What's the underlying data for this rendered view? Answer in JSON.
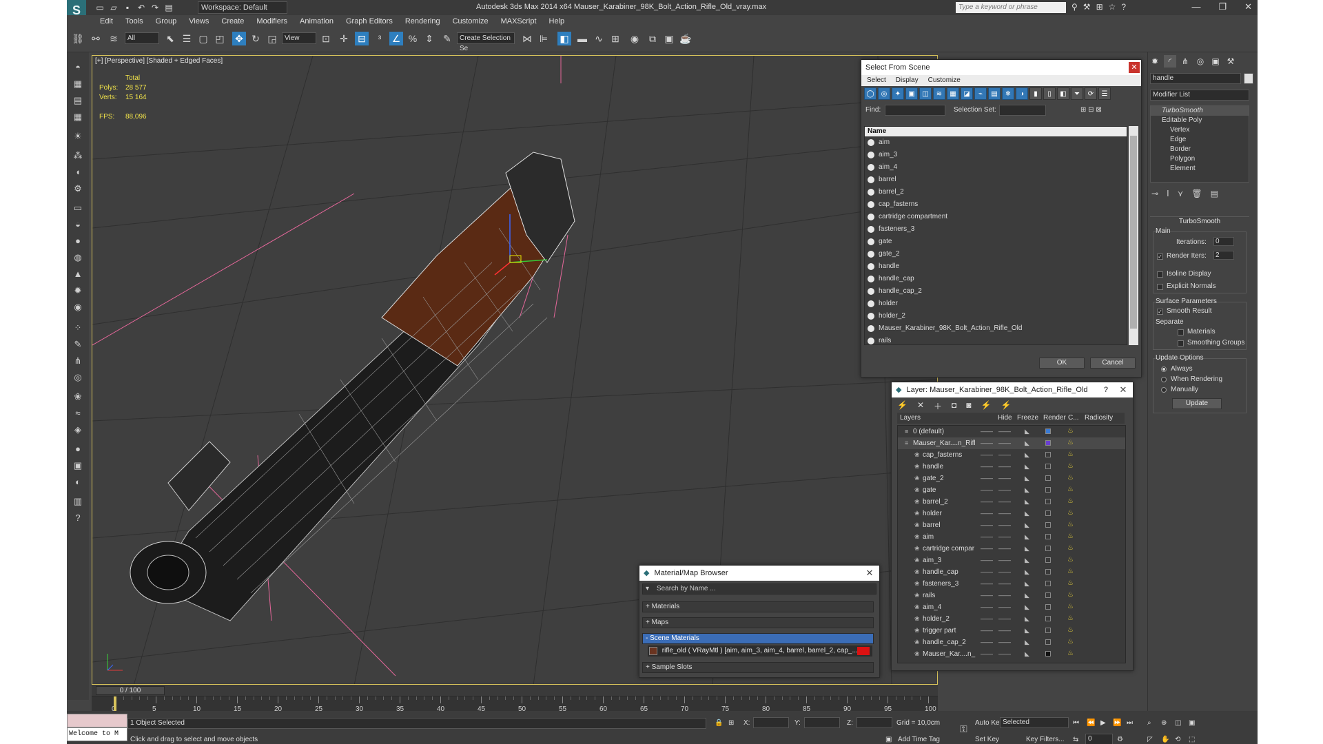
{
  "window": {
    "title": "Autodesk 3ds Max  2014 x64      Mauser_Karabiner_98K_Bolt_Action_Rifle_Old_vray.max",
    "workspace": "Workspace: Default",
    "search_placeholder": "Type a keyword or phrase"
  },
  "menu": [
    "Edit",
    "Tools",
    "Group",
    "Views",
    "Create",
    "Modifiers",
    "Animation",
    "Graph Editors",
    "Rendering",
    "Customize",
    "MAXScript",
    "Help"
  ],
  "toolbar": {
    "filter": "All",
    "ref_coord": "View",
    "selection_set": "Create Selection Se"
  },
  "viewport": {
    "label": "[+] [Perspective] [Shaded + Edged Faces]",
    "stats_header": "Total",
    "polys_label": "Polys:",
    "polys_value": "28 577",
    "verts_label": "Verts:",
    "verts_value": "15 164",
    "fps_label": "FPS:",
    "fps_value": "88,096"
  },
  "select_from_scene": {
    "title": "Select From Scene",
    "menu": [
      "Select",
      "Display",
      "Customize"
    ],
    "find_label": "Find:",
    "selection_set_label": "Selection Set:",
    "column_name": "Name",
    "items": [
      "aim",
      "aim_3",
      "aim_4",
      "barrel",
      "barrel_2",
      "cap_fasterns",
      "cartridge compartment",
      "fasteners_3",
      "gate",
      "gate_2",
      "handle",
      "handle_cap",
      "handle_cap_2",
      "holder",
      "holder_2",
      "Mauser_Karabiner_98K_Bolt_Action_Rifle_Old",
      "rails"
    ],
    "ok": "OK",
    "cancel": "Cancel"
  },
  "layer_dialog": {
    "title": "Layer: Mauser_Karabiner_98K_Bolt_Action_Rifle_Old",
    "help": "?",
    "columns": [
      "Layers",
      "Hide",
      "Freeze",
      "Render",
      "C...",
      "Radiosity"
    ],
    "rows": [
      {
        "name": "0 (default)",
        "indent": 0,
        "color": "#3a7bd5"
      },
      {
        "name": "Mauser_Kar....n_Rifl",
        "indent": 0,
        "color": "#6a3fd0"
      },
      {
        "name": "cap_fasterns",
        "indent": 1,
        "color": ""
      },
      {
        "name": "handle",
        "indent": 1,
        "color": ""
      },
      {
        "name": "gate_2",
        "indent": 1,
        "color": ""
      },
      {
        "name": "gate",
        "indent": 1,
        "color": ""
      },
      {
        "name": "barrel_2",
        "indent": 1,
        "color": ""
      },
      {
        "name": "holder",
        "indent": 1,
        "color": ""
      },
      {
        "name": "barrel",
        "indent": 1,
        "color": ""
      },
      {
        "name": "aim",
        "indent": 1,
        "color": ""
      },
      {
        "name": "cartridge compar",
        "indent": 1,
        "color": ""
      },
      {
        "name": "aim_3",
        "indent": 1,
        "color": ""
      },
      {
        "name": "handle_cap",
        "indent": 1,
        "color": ""
      },
      {
        "name": "fasteners_3",
        "indent": 1,
        "color": ""
      },
      {
        "name": "rails",
        "indent": 1,
        "color": ""
      },
      {
        "name": "aim_4",
        "indent": 1,
        "color": ""
      },
      {
        "name": "holder_2",
        "indent": 1,
        "color": ""
      },
      {
        "name": "trigger part",
        "indent": 1,
        "color": ""
      },
      {
        "name": "handle_cap_2",
        "indent": 1,
        "color": ""
      },
      {
        "name": "Mauser_Kar....n_",
        "indent": 1,
        "color": "#111111"
      }
    ]
  },
  "material_browser": {
    "title": "Material/Map Browser",
    "search_placeholder": "Search by Name ...",
    "sections": [
      "+ Materials",
      "+ Maps",
      "- Scene Materials",
      "+ Sample Slots"
    ],
    "material_entry": "rifle_old  ( VRayMtl )  [aim, aim_3, aim_4, barrel, barrel_2, cap_..."
  },
  "command_panel": {
    "object_name": "handle",
    "modifier_list": "Modifier List",
    "stack": [
      "TurboSmooth",
      "Editable Poly",
      "Vertex",
      "Edge",
      "Border",
      "Polygon",
      "Element"
    ],
    "rollout_title": "TurboSmooth",
    "main_label": "Main",
    "iterations_label": "Iterations:",
    "iterations_value": "0",
    "render_iters_label": "Render Iters:",
    "render_iters_value": "2",
    "isoline": "Isoline Display",
    "explicit_normals": "Explicit Normals",
    "surface_params": "Surface Parameters",
    "smooth_result": "Smooth Result",
    "separate": "Separate",
    "materials": "Materials",
    "smoothing_groups": "Smoothing Groups",
    "update_options": "Update Options",
    "always": "Always",
    "when_rendering": "When Rendering",
    "manually": "Manually",
    "update_btn": "Update"
  },
  "timeline": {
    "slider": "0 / 100",
    "ticks": [
      "0",
      "5",
      "10",
      "15",
      "20",
      "25",
      "30",
      "35",
      "40",
      "45",
      "50",
      "55",
      "60",
      "65",
      "70",
      "75",
      "80",
      "85",
      "90",
      "95",
      "100"
    ]
  },
  "status": {
    "maxscript": "Welcome to M",
    "selected": "1 Object Selected",
    "prompt": "Click and drag to select and move objects",
    "x_label": "X:",
    "y_label": "Y:",
    "z_label": "Z:",
    "grid": "Grid = 10,0cm",
    "add_time_tag": "Add Time Tag",
    "auto_key": "Auto Key",
    "set_key": "Set Key",
    "selected_dd": "Selected",
    "key_filters": "Key Filters...",
    "frame": "0"
  }
}
